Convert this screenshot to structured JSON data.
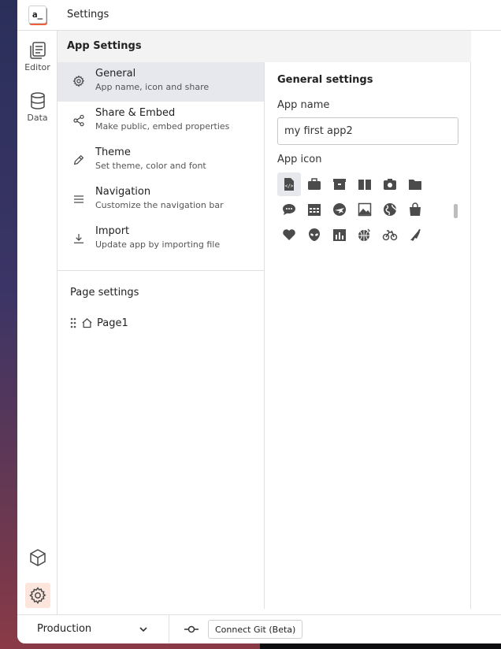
{
  "header": {
    "logo_text": "a_",
    "title": "Settings"
  },
  "rail": {
    "items": [
      {
        "label": "Editor",
        "icon": "editor-pages-icon"
      },
      {
        "label": "Data",
        "icon": "database-icon"
      }
    ],
    "bottom_icons": [
      "cube-icon",
      "gear-icon"
    ]
  },
  "settings": {
    "heading": "App Settings",
    "nav": [
      {
        "title": "General",
        "subtitle": "App name, icon and share",
        "icon": "gear-icon",
        "active": true
      },
      {
        "title": "Share & Embed",
        "subtitle": "Make public, embed properties",
        "icon": "share-icon",
        "active": false
      },
      {
        "title": "Theme",
        "subtitle": "Set theme, color and font",
        "icon": "pencil-icon",
        "active": false
      },
      {
        "title": "Navigation",
        "subtitle": "Customize the navigation bar",
        "icon": "menu-lines-icon",
        "active": false
      },
      {
        "title": "Import",
        "subtitle": "Update app by importing file",
        "icon": "download-icon",
        "active": false
      }
    ],
    "page_settings_title": "Page settings",
    "pages": [
      {
        "name": "Page1",
        "icon": "home-icon"
      }
    ]
  },
  "general": {
    "title": "General settings",
    "app_name_label": "App name",
    "app_name_value": "my first app2",
    "app_icon_label": "App icon",
    "icons": [
      "code-file-icon",
      "briefcase-icon",
      "box-icon",
      "book-icon",
      "camera-icon",
      "folder-icon",
      "chat-icon",
      "calendar-icon",
      "airplane-icon",
      "image-icon",
      "globe-icon",
      "shopping-bag-icon",
      "heart-icon",
      "alien-icon",
      "bar-chart-icon",
      "basketball-icon",
      "bicycle-icon",
      "bird-icon"
    ],
    "selected_icon": "code-file-icon"
  },
  "bottombar": {
    "environment": "Production",
    "git_button": "Connect Git (Beta)"
  },
  "colors": {
    "accent": "#e8603c",
    "active_bg": "#e6e8ee",
    "gear_active_bg": "#fbe5dd",
    "icon_dark": "#4b4b4b"
  }
}
